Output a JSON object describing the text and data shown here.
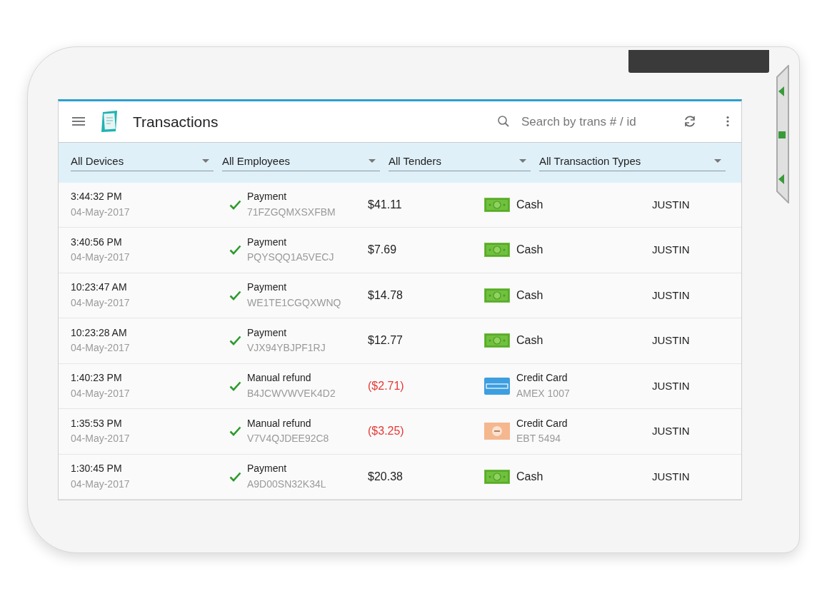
{
  "app_bar": {
    "title": "Transactions",
    "search": {
      "placeholder": "Search by trans # / id"
    }
  },
  "filters": [
    {
      "label": "All Devices"
    },
    {
      "label": "All Employees"
    },
    {
      "label": "All Tenders"
    },
    {
      "label": "All Transaction Types"
    }
  ],
  "transactions": [
    {
      "time": "3:44:32 PM",
      "date": "04-May-2017",
      "completed": true,
      "type": "Payment",
      "id": "71FZGQMXSXFBM",
      "amount": "$41.11",
      "negative": false,
      "tender": {
        "kind": "cash",
        "label": "Cash"
      },
      "employee": "JUSTIN"
    },
    {
      "time": "3:40:56 PM",
      "date": "04-May-2017",
      "completed": true,
      "type": "Payment",
      "id": "PQYSQQ1A5VECJ",
      "amount": "$7.69",
      "negative": false,
      "tender": {
        "kind": "cash",
        "label": "Cash"
      },
      "employee": "JUSTIN"
    },
    {
      "time": "10:23:47 AM",
      "date": "04-May-2017",
      "completed": true,
      "type": "Payment",
      "id": "WE1TE1CGQXWNQ",
      "amount": "$14.78",
      "negative": false,
      "tender": {
        "kind": "cash",
        "label": "Cash"
      },
      "employee": "JUSTIN"
    },
    {
      "time": "10:23:28 AM",
      "date": "04-May-2017",
      "completed": true,
      "type": "Payment",
      "id": "VJX94YBJPF1RJ",
      "amount": "$12.77",
      "negative": false,
      "tender": {
        "kind": "cash",
        "label": "Cash"
      },
      "employee": "JUSTIN"
    },
    {
      "time": "1:40:23 PM",
      "date": "04-May-2017",
      "completed": true,
      "type": "Manual refund",
      "id": "B4JCWVWVEK4D2",
      "amount": "($2.71)",
      "negative": true,
      "tender": {
        "kind": "amex",
        "label": "Credit Card",
        "detail": "AMEX 1007"
      },
      "employee": "JUSTIN"
    },
    {
      "time": "1:35:53 PM",
      "date": "04-May-2017",
      "completed": true,
      "type": "Manual refund",
      "id": "V7V4QJDEE92C8",
      "amount": "($3.25)",
      "negative": true,
      "tender": {
        "kind": "ebt",
        "label": "Credit Card",
        "detail": "EBT 5494"
      },
      "employee": "JUSTIN"
    },
    {
      "time": "1:30:45 PM",
      "date": "04-May-2017",
      "completed": true,
      "type": "Payment",
      "id": "A9D00SN32K34L",
      "amount": "$20.38",
      "negative": false,
      "tender": {
        "kind": "cash",
        "label": "Cash"
      },
      "employee": "JUSTIN"
    }
  ]
}
